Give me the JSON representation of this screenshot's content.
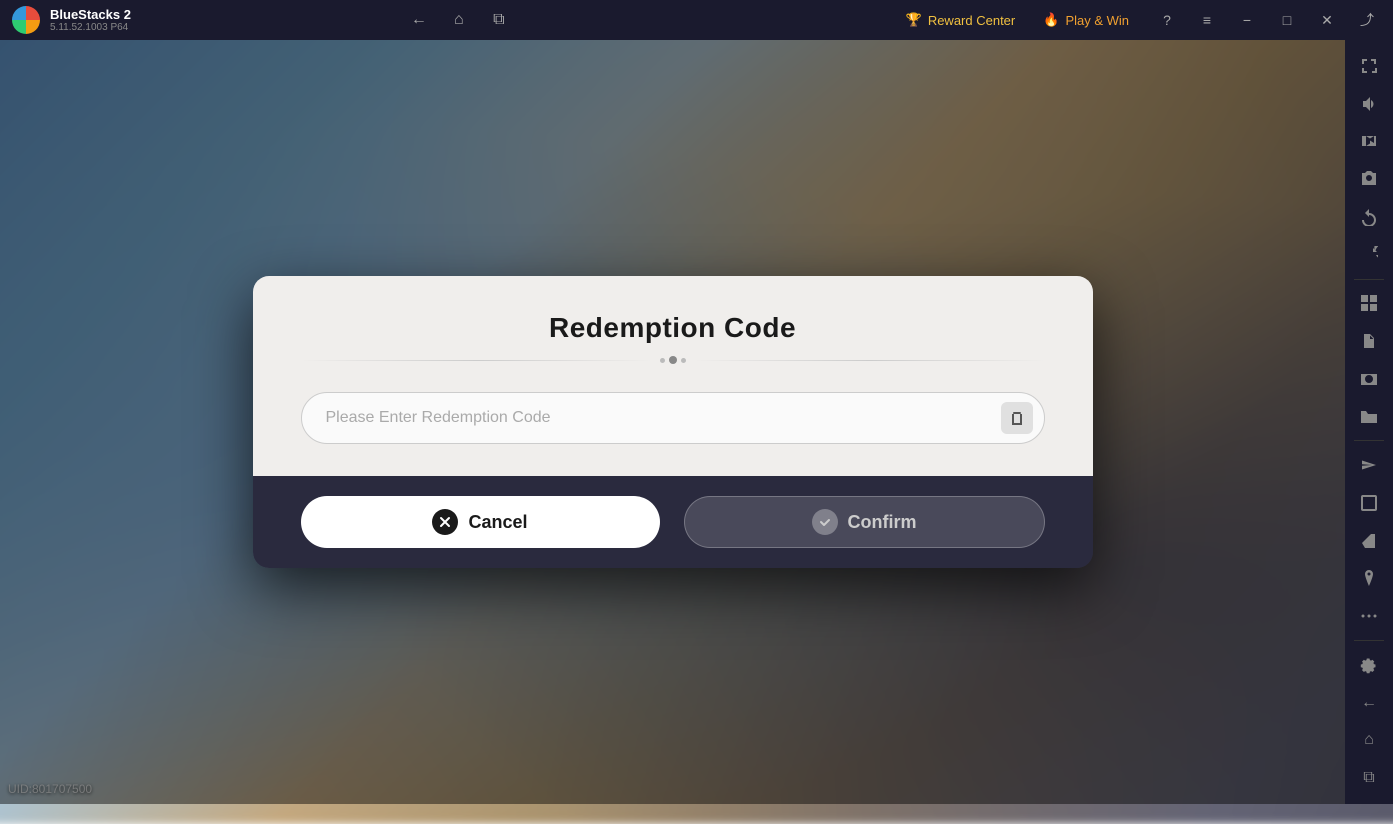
{
  "app": {
    "name": "BlueStacks 2",
    "version": "5.11.52.1003",
    "arch": "P64"
  },
  "titlebar": {
    "back_label": "←",
    "home_label": "⌂",
    "copy_label": "⧉",
    "reward_center_label": "Reward Center",
    "play_win_label": "Play & Win",
    "help_label": "?",
    "menu_label": "≡",
    "minimize_label": "−",
    "restore_label": "⬜",
    "close_label": "✕",
    "expand_label": "⤢"
  },
  "sidebar": {
    "icons": [
      {
        "name": "expand-icon",
        "symbol": "⤢"
      },
      {
        "name": "volume-icon",
        "symbol": "🔊"
      },
      {
        "name": "video-icon",
        "symbol": "▶"
      },
      {
        "name": "camera-alt-icon",
        "symbol": "📹"
      },
      {
        "name": "rotate-icon",
        "symbol": "↺"
      },
      {
        "name": "refresh-icon",
        "symbol": "🔄"
      },
      {
        "name": "apps-icon",
        "symbol": "⊞"
      },
      {
        "name": "files-icon",
        "symbol": "📋"
      },
      {
        "name": "screenshot-icon",
        "symbol": "📷"
      },
      {
        "name": "folder-icon",
        "symbol": "📁"
      },
      {
        "name": "plane-icon",
        "symbol": "✈"
      },
      {
        "name": "resize-icon",
        "symbol": "⬛"
      },
      {
        "name": "eraser-icon",
        "symbol": "✏"
      },
      {
        "name": "pin-icon",
        "symbol": "📍"
      },
      {
        "name": "more-icon",
        "symbol": "…"
      },
      {
        "name": "settings-icon",
        "symbol": "⚙"
      },
      {
        "name": "back-nav-icon",
        "symbol": "←"
      },
      {
        "name": "home-nav-icon",
        "symbol": "⌂"
      },
      {
        "name": "clipboard-nav-icon",
        "symbol": "⧉"
      }
    ]
  },
  "dialog": {
    "title": "Redemption Code",
    "input_placeholder": "Please Enter Redemption Code",
    "cancel_label": "Cancel",
    "confirm_label": "Confirm",
    "divider_dots": 3
  },
  "footer": {
    "uid_label": "UID:801707500"
  }
}
